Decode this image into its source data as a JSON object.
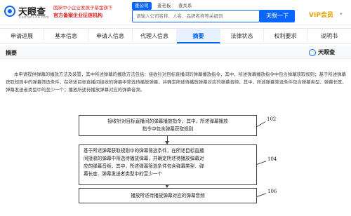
{
  "header": {
    "logo_text": "天眼查",
    "logo_sub": "TianYanCha.com",
    "badge_line1": "国家中小企业发展子基金旗下",
    "badge_line2": "官方备案企业征信机构",
    "search_tabs": [
      "查公司",
      "查老板",
      "查关系"
    ],
    "search_placeholder": "请输入公司名称、人名、品牌名称等关键词",
    "search_button": "天眼一下",
    "vip_label": "VIP会员"
  },
  "tabs": [
    "申请进展",
    "基本信息",
    "申请人信息",
    "代理人信息",
    "摘要",
    "法律状态",
    "权利要求",
    "说明书"
  ],
  "active_tab": "摘要",
  "section": {
    "title": "摘要",
    "watermark": "天眼查"
  },
  "abstract": "本申请提供弹幕的播放方法及装置，其中所述弹幕的播放方法包括：接收针对目标直播间的弹幕播放指令，其中，所述弹幕播放指令中包含弹幕获取规则；基于所述弹幕获取规则中的弹幕筛选条件，在所述目标直播间接收的弹幕中筛选待播放弹幕，并确定所述待播放弹幕对应的弹幕音频，其中，所述弹幕筛选条件包含弹幕类型、弹幕长度、弹幕发送者类型中的至少一个；播放所述待播放弹幕对应的弹幕音频。",
  "flowchart": {
    "step1": [
      "接收针对目标直播间的弹幕播放指令，其中，所述弹幕播放",
      "指令中包含弹幕获取规则"
    ],
    "step2": [
      "基于所述弹幕获取规则中的弹幕筛选条件，在所述目标直播",
      "间接收的弹幕中筛选待播放弹幕，并确定所述待播放弹幕对",
      "应的弹幕音频，其中，所述弹幕筛选条件包含弹幕类型、弹",
      "幕长度、弹幕发送者类型中的至少一个"
    ],
    "step3": [
      "播放所述待播放弹幕对应的弹幕音频"
    ],
    "refs": [
      "102",
      "104",
      "106"
    ]
  }
}
